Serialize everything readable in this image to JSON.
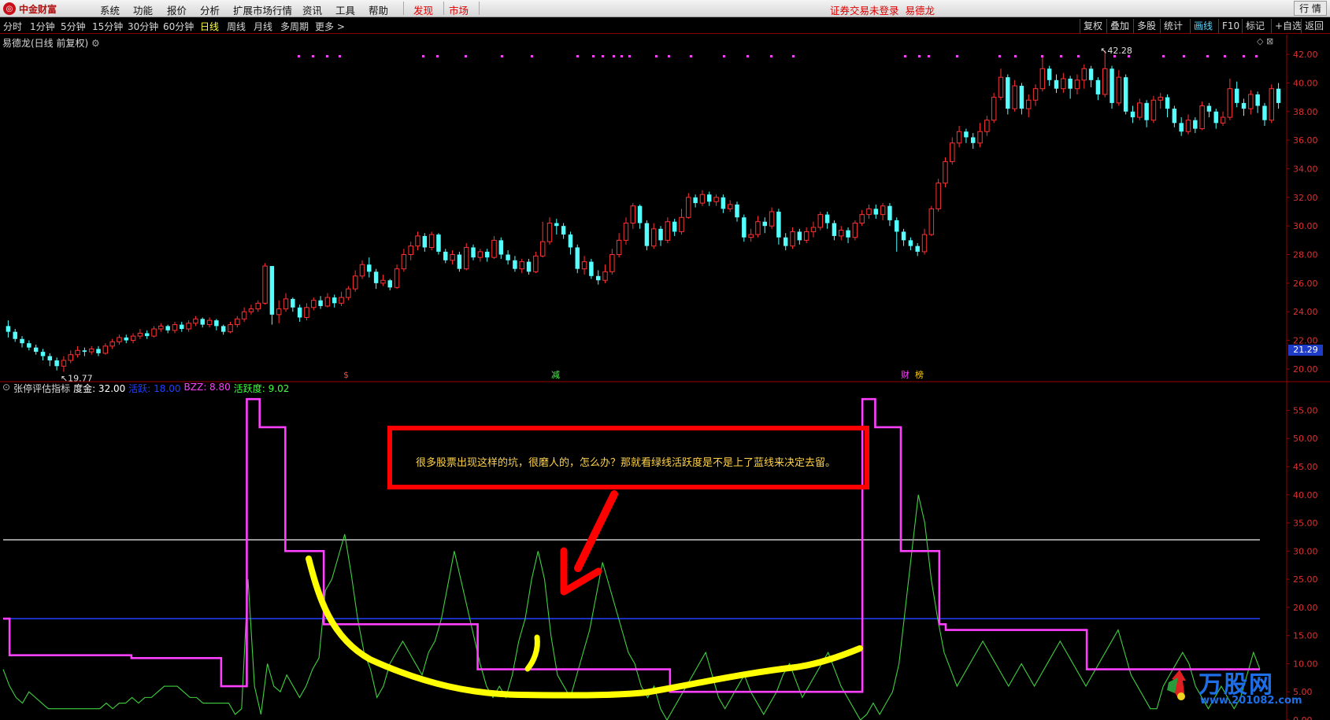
{
  "menubar": {
    "logo_text": "中金财富",
    "items": [
      "系统",
      "功能",
      "报价",
      "分析",
      "扩展市场行情",
      "资讯",
      "工具",
      "帮助"
    ],
    "highlight_items": [
      "发现",
      "市场"
    ],
    "login_status": "证券交易未登录",
    "stock_name": "易德龙",
    "window_button": "行 情"
  },
  "toolbar": {
    "periods": [
      "分时",
      "1分钟",
      "5分钟",
      "15分钟",
      "30分钟",
      "60分钟",
      "日线",
      "周线",
      "月线",
      "多周期",
      "更多 >"
    ],
    "active_period": "日线",
    "right_buttons": [
      "复权",
      "叠加",
      "多股",
      "统计",
      "画线",
      "F10",
      "标记",
      "+自选",
      "返回"
    ],
    "active_right": "画线"
  },
  "main_pane": {
    "title": "易德龙(日线 前复权)",
    "high_label": "42.28",
    "low_label": "19.77",
    "current_price": "21.29",
    "price_axis": [
      "42.00",
      "40.00",
      "38.00",
      "36.00",
      "34.00",
      "32.00",
      "30.00",
      "28.00",
      "26.00",
      "24.00",
      "22.00",
      "20.00"
    ],
    "event_markers": [
      {
        "text": "$",
        "color": "#ff4040"
      },
      {
        "text": "减",
        "color": "#40ff40"
      },
      {
        "text": "财",
        "color": "#ff40ff"
      },
      {
        "text": "榜",
        "color": "#ffcc00"
      }
    ]
  },
  "indicator_pane": {
    "name": "张停评估指标",
    "params": [
      {
        "label": "度金: 32.00",
        "color": "#ffffff"
      },
      {
        "label": "活跃: 18.00",
        "color": "#2040ff"
      },
      {
        "label": "BZZ: 8.80",
        "color": "#ff40ff"
      },
      {
        "label": "活跃度: 9.02",
        "color": "#40ff40"
      }
    ],
    "axis": [
      "55.00",
      "50.00",
      "45.00",
      "40.00",
      "35.00",
      "30.00",
      "25.00",
      "20.00",
      "15.00",
      "10.00",
      "5.00",
      "0.00"
    ]
  },
  "annotation": {
    "text": "很多股票出现这样的坑，很磨人的，怎么办？那就看绿线活跃度是不是上了蓝线来决定去留。"
  },
  "watermark": {
    "title": "万股网",
    "url": "www.201082.com"
  },
  "colors": {
    "up": "#ff3232",
    "down": "#54ffff",
    "bzz": "#ff40ff",
    "activity": "#40d040",
    "blue_line": "#2040ff",
    "white_line": "#c8c8c8",
    "annotation_arrow": "#ff0000",
    "highlight_curve": "#ffff00"
  },
  "chart_data": {
    "type": "line",
    "price_range": [
      19.5,
      42.5
    ],
    "indicator_range": [
      0,
      58
    ],
    "candles": [
      [
        23.0,
        22.6,
        23.4,
        22.2
      ],
      [
        22.6,
        22.1,
        22.8,
        21.9
      ],
      [
        22.1,
        21.8,
        22.3,
        21.5
      ],
      [
        21.8,
        21.5,
        22.0,
        21.3
      ],
      [
        21.5,
        21.2,
        21.7,
        21.0
      ],
      [
        21.2,
        20.9,
        21.4,
        20.6
      ],
      [
        20.9,
        20.6,
        21.1,
        20.2
      ],
      [
        20.6,
        20.2,
        20.8,
        19.9
      ],
      [
        20.2,
        20.6,
        20.9,
        19.8
      ],
      [
        20.6,
        21.0,
        21.3,
        20.4
      ],
      [
        21.0,
        21.3,
        21.6,
        20.8
      ],
      [
        21.3,
        21.2,
        21.5,
        20.9
      ],
      [
        21.2,
        21.4,
        21.6,
        21.0
      ],
      [
        21.4,
        21.1,
        21.6,
        20.9
      ],
      [
        21.1,
        21.6,
        21.8,
        21.0
      ],
      [
        21.6,
        21.9,
        22.1,
        21.4
      ],
      [
        21.9,
        22.2,
        22.4,
        21.7
      ],
      [
        22.2,
        22.0,
        22.4,
        21.8
      ],
      [
        22.0,
        22.3,
        22.5,
        21.8
      ],
      [
        22.3,
        22.5,
        22.8,
        22.1
      ],
      [
        22.5,
        22.3,
        22.7,
        22.1
      ],
      [
        22.3,
        22.8,
        23.0,
        22.2
      ],
      [
        22.8,
        23.0,
        23.2,
        22.6
      ],
      [
        23.0,
        22.7,
        23.1,
        22.5
      ],
      [
        22.7,
        23.1,
        23.3,
        22.5
      ],
      [
        23.1,
        22.8,
        23.3,
        22.6
      ],
      [
        22.8,
        23.2,
        23.4,
        22.6
      ],
      [
        23.2,
        23.5,
        23.7,
        23.0
      ],
      [
        23.5,
        23.1,
        23.6,
        22.9
      ],
      [
        23.1,
        23.4,
        23.6,
        22.9
      ],
      [
        23.4,
        23.0,
        23.5,
        22.7
      ],
      [
        23.0,
        22.6,
        23.1,
        22.4
      ],
      [
        22.6,
        23.1,
        23.3,
        22.5
      ],
      [
        23.1,
        23.5,
        23.7,
        22.9
      ],
      [
        23.5,
        24.0,
        24.3,
        23.3
      ],
      [
        24.0,
        24.2,
        24.5,
        23.8
      ],
      [
        24.2,
        24.6,
        24.8,
        24.0
      ],
      [
        24.6,
        27.2,
        27.4,
        24.5
      ],
      [
        27.2,
        23.8,
        27.0,
        23.1
      ],
      [
        23.8,
        24.2,
        24.8,
        23.2
      ],
      [
        24.2,
        24.9,
        25.3,
        24.0
      ],
      [
        24.9,
        24.3,
        25.0,
        24.0
      ],
      [
        24.3,
        23.6,
        24.5,
        23.3
      ],
      [
        23.6,
        24.3,
        24.6,
        23.4
      ],
      [
        24.3,
        24.8,
        25.0,
        24.1
      ],
      [
        24.8,
        24.4,
        25.1,
        24.2
      ],
      [
        24.4,
        25.0,
        25.3,
        24.3
      ],
      [
        25.0,
        24.6,
        25.2,
        24.3
      ],
      [
        24.6,
        25.0,
        25.4,
        24.4
      ],
      [
        25.0,
        25.6,
        25.8,
        24.8
      ],
      [
        25.6,
        26.5,
        26.9,
        25.4
      ],
      [
        26.5,
        27.3,
        27.6,
        26.3
      ],
      [
        27.3,
        26.8,
        27.8,
        26.4
      ],
      [
        26.8,
        26.0,
        27.0,
        25.6
      ],
      [
        26.0,
        26.2,
        26.6,
        25.8
      ],
      [
        26.2,
        25.7,
        26.3,
        25.5
      ],
      [
        25.7,
        27.0,
        27.3,
        25.6
      ],
      [
        27.0,
        28.0,
        28.4,
        26.8
      ],
      [
        28.0,
        28.6,
        28.9,
        27.6
      ],
      [
        28.6,
        29.3,
        29.6,
        28.3
      ],
      [
        29.3,
        28.5,
        29.5,
        28.2
      ],
      [
        28.5,
        29.4,
        29.6,
        28.3
      ],
      [
        29.4,
        28.2,
        29.5,
        28.0
      ],
      [
        28.2,
        27.6,
        28.4,
        27.4
      ],
      [
        27.6,
        28.0,
        28.3,
        27.3
      ],
      [
        28.0,
        27.0,
        28.2,
        26.8
      ],
      [
        27.0,
        28.5,
        28.8,
        26.9
      ],
      [
        28.5,
        27.8,
        28.7,
        27.6
      ],
      [
        27.8,
        28.2,
        28.4,
        27.5
      ],
      [
        28.2,
        27.8,
        28.4,
        27.5
      ],
      [
        27.8,
        29.0,
        29.3,
        27.7
      ],
      [
        29.0,
        28.0,
        29.2,
        27.7
      ],
      [
        28.0,
        27.6,
        28.3,
        27.3
      ],
      [
        27.6,
        27.0,
        27.9,
        26.8
      ],
      [
        27.0,
        27.5,
        27.7,
        26.7
      ],
      [
        27.5,
        26.8,
        27.7,
        26.6
      ],
      [
        26.8,
        27.9,
        28.2,
        26.7
      ],
      [
        27.9,
        28.9,
        30.3,
        27.8
      ],
      [
        28.9,
        30.2,
        30.6,
        28.7
      ],
      [
        30.2,
        30.0,
        30.5,
        29.4
      ],
      [
        30.0,
        29.4,
        30.2,
        29.1
      ],
      [
        29.4,
        28.5,
        29.6,
        28.0
      ],
      [
        28.5,
        27.0,
        28.7,
        26.7
      ],
      [
        27.0,
        27.5,
        27.9,
        26.6
      ],
      [
        27.5,
        26.5,
        27.7,
        26.3
      ],
      [
        26.5,
        26.2,
        26.9,
        25.9
      ],
      [
        26.2,
        26.8,
        27.3,
        26.0
      ],
      [
        26.8,
        28.0,
        28.4,
        26.6
      ],
      [
        28.0,
        29.0,
        29.5,
        27.8
      ],
      [
        29.0,
        30.2,
        30.6,
        28.7
      ],
      [
        30.2,
        31.4,
        31.6,
        29.8
      ],
      [
        31.4,
        30.2,
        31.5,
        29.8
      ],
      [
        30.2,
        28.6,
        30.4,
        28.3
      ],
      [
        28.6,
        29.8,
        30.2,
        28.4
      ],
      [
        29.8,
        29.0,
        30.0,
        28.6
      ],
      [
        29.0,
        30.3,
        30.6,
        28.8
      ],
      [
        30.3,
        29.6,
        30.5,
        29.3
      ],
      [
        29.6,
        30.6,
        31.2,
        29.4
      ],
      [
        30.6,
        32.0,
        32.3,
        30.5
      ],
      [
        32.0,
        31.6,
        32.2,
        31.3
      ],
      [
        31.6,
        32.2,
        32.5,
        31.4
      ],
      [
        32.2,
        31.7,
        32.4,
        31.4
      ],
      [
        31.7,
        32.0,
        32.2,
        31.4
      ],
      [
        32.0,
        31.2,
        32.2,
        30.9
      ],
      [
        31.2,
        31.5,
        31.8,
        31.0
      ],
      [
        31.5,
        30.6,
        31.7,
        30.3
      ],
      [
        30.6,
        29.2,
        30.8,
        28.9
      ],
      [
        29.2,
        29.4,
        29.8,
        28.9
      ],
      [
        29.4,
        30.3,
        30.7,
        29.2
      ],
      [
        30.3,
        30.0,
        30.6,
        29.5
      ],
      [
        30.0,
        31.0,
        31.3,
        29.8
      ],
      [
        31.0,
        29.2,
        31.2,
        28.7
      ],
      [
        29.2,
        28.6,
        29.5,
        28.3
      ],
      [
        28.6,
        29.6,
        29.9,
        28.4
      ],
      [
        29.6,
        29.0,
        29.8,
        28.7
      ],
      [
        29.0,
        29.6,
        29.9,
        28.8
      ],
      [
        29.6,
        29.9,
        30.3,
        29.2
      ],
      [
        29.9,
        30.8,
        31.0,
        29.7
      ],
      [
        30.8,
        30.2,
        31.0,
        29.8
      ],
      [
        30.2,
        29.3,
        30.4,
        29.0
      ],
      [
        29.3,
        29.7,
        30.0,
        29.0
      ],
      [
        29.7,
        29.2,
        29.9,
        28.8
      ],
      [
        29.2,
        30.2,
        30.4,
        29.0
      ],
      [
        30.2,
        30.8,
        31.1,
        30.0
      ],
      [
        30.8,
        31.2,
        31.5,
        30.5
      ],
      [
        31.2,
        30.8,
        31.5,
        30.5
      ],
      [
        30.8,
        31.4,
        31.6,
        30.4
      ],
      [
        31.4,
        30.4,
        31.6,
        30.0
      ],
      [
        30.4,
        29.6,
        30.6,
        28.2
      ],
      [
        29.6,
        29.0,
        29.8,
        28.6
      ],
      [
        29.0,
        28.6,
        29.2,
        28.3
      ],
      [
        28.6,
        28.2,
        28.8,
        27.9
      ],
      [
        28.2,
        29.4,
        29.8,
        28.0
      ],
      [
        29.4,
        31.2,
        31.4,
        29.3
      ],
      [
        31.2,
        33.0,
        33.3,
        31.0
      ],
      [
        33.0,
        34.5,
        34.8,
        32.7
      ],
      [
        34.5,
        35.8,
        36.2,
        34.3
      ],
      [
        35.8,
        36.6,
        37.0,
        35.5
      ],
      [
        36.6,
        36.2,
        36.8,
        35.8
      ],
      [
        36.2,
        35.8,
        36.5,
        35.4
      ],
      [
        35.8,
        36.6,
        37.2,
        35.5
      ],
      [
        36.6,
        37.4,
        37.7,
        36.3
      ],
      [
        37.4,
        39.0,
        39.3,
        37.2
      ],
      [
        39.0,
        40.4,
        41.0,
        38.8
      ],
      [
        40.4,
        38.2,
        40.6,
        37.8
      ],
      [
        38.2,
        39.8,
        40.2,
        38.0
      ],
      [
        39.8,
        38.2,
        40.0,
        37.8
      ],
      [
        38.2,
        38.8,
        39.2,
        37.6
      ],
      [
        38.8,
        39.6,
        39.9,
        38.4
      ],
      [
        39.6,
        41.0,
        41.9,
        39.4
      ],
      [
        41.0,
        40.2,
        41.2,
        39.8
      ],
      [
        40.2,
        39.6,
        40.6,
        39.3
      ],
      [
        39.6,
        40.3,
        40.7,
        39.3
      ],
      [
        40.3,
        39.6,
        40.5,
        38.9
      ],
      [
        39.6,
        40.2,
        40.6,
        39.2
      ],
      [
        40.2,
        41.0,
        41.3,
        39.6
      ],
      [
        41.0,
        40.2,
        41.2,
        39.7
      ],
      [
        40.2,
        39.2,
        40.4,
        38.8
      ],
      [
        39.2,
        41.0,
        42.28,
        39.0
      ],
      [
        41.0,
        38.6,
        41.2,
        38.2
      ],
      [
        38.6,
        40.4,
        40.9,
        38.4
      ],
      [
        40.4,
        38.0,
        40.6,
        37.8
      ],
      [
        38.0,
        37.6,
        38.4,
        37.2
      ],
      [
        37.6,
        38.6,
        38.9,
        37.4
      ],
      [
        38.6,
        37.4,
        38.8,
        36.9
      ],
      [
        37.4,
        38.8,
        39.1,
        37.2
      ],
      [
        38.8,
        39.0,
        39.3,
        38.2
      ],
      [
        39.0,
        38.2,
        39.2,
        37.6
      ],
      [
        38.2,
        37.2,
        38.4,
        36.9
      ],
      [
        37.2,
        36.6,
        37.6,
        36.3
      ],
      [
        36.6,
        37.4,
        37.8,
        36.4
      ],
      [
        37.4,
        36.8,
        37.6,
        36.5
      ],
      [
        36.8,
        38.4,
        38.7,
        36.7
      ],
      [
        38.4,
        38.0,
        38.6,
        37.6
      ],
      [
        38.0,
        37.2,
        38.2,
        36.8
      ],
      [
        37.2,
        37.6,
        38.0,
        37.0
      ],
      [
        37.6,
        39.6,
        40.3,
        37.4
      ],
      [
        39.6,
        38.6,
        40.1,
        38.3
      ],
      [
        38.6,
        38.2,
        38.9,
        37.7
      ],
      [
        38.2,
        39.2,
        39.5,
        37.8
      ],
      [
        39.2,
        38.4,
        39.4,
        37.9
      ],
      [
        38.4,
        37.4,
        38.6,
        37.0
      ],
      [
        37.4,
        39.6,
        39.9,
        37.2
      ],
      [
        39.6,
        38.6,
        40.0,
        38.2
      ]
    ],
    "bzz_series": [
      18,
      11.5,
      11.5,
      11.5,
      11.5,
      11.5,
      11.5,
      11.5,
      11.5,
      11.5,
      11.5,
      11.5,
      11.5,
      11.5,
      11.5,
      11.5,
      11.5,
      11.5,
      11.5,
      11.5,
      11,
      11,
      11,
      11,
      11,
      11,
      11,
      11,
      11,
      11,
      11,
      11,
      11,
      11,
      6,
      6,
      6,
      6,
      57,
      57,
      52,
      52,
      52,
      52,
      30,
      30,
      30,
      30,
      30,
      30,
      17,
      17,
      17,
      17,
      17,
      17,
      17,
      17,
      17,
      17,
      17,
      17,
      17,
      17,
      17,
      17,
      17,
      17,
      17,
      17,
      17,
      17,
      17,
      17,
      9,
      9,
      9,
      9,
      9,
      9,
      9,
      9,
      9,
      9,
      9,
      9,
      9,
      9,
      9,
      9,
      9,
      9,
      9,
      9,
      9,
      9,
      9,
      9,
      9,
      9,
      9,
      9,
      9,
      9,
      5,
      5,
      5,
      5,
      5,
      5,
      5,
      5,
      5,
      5,
      5,
      5,
      5,
      5,
      5,
      5,
      5,
      5,
      5,
      5,
      5,
      5,
      5,
      5,
      5,
      5,
      5,
      5,
      5,
      5,
      57,
      57,
      52,
      52,
      52,
      52,
      30,
      30,
      30,
      30,
      30,
      30,
      17,
      16,
      16,
      16,
      16,
      16,
      16,
      16,
      16,
      16,
      16,
      16,
      16,
      16,
      16,
      16,
      16,
      16,
      16,
      16,
      16,
      16,
      16,
      9,
      9,
      9,
      9,
      9,
      9,
      9,
      9,
      9,
      9,
      9,
      9,
      9,
      9,
      9,
      9,
      9,
      9,
      9,
      9,
      9,
      9,
      9,
      9,
      9,
      9,
      9,
      9
    ],
    "activity_series": [
      9,
      6,
      4,
      3,
      5,
      4,
      3,
      2,
      2,
      2,
      2,
      2,
      2,
      2,
      2,
      2,
      3,
      2,
      3,
      3,
      4,
      3,
      4,
      4,
      5,
      6,
      6,
      6,
      5,
      4,
      4,
      3,
      3,
      3,
      3,
      3,
      1,
      2,
      25,
      6,
      1,
      10,
      6,
      5,
      8,
      6,
      4,
      6,
      9,
      11,
      23,
      25,
      29,
      33,
      26,
      18,
      12,
      9,
      4,
      6,
      10,
      12,
      14,
      12,
      10,
      8,
      12,
      14,
      18,
      24,
      30,
      25,
      20,
      15,
      10,
      6,
      4,
      6,
      4,
      8,
      14,
      18,
      25,
      30,
      25,
      15,
      8,
      6,
      4,
      8,
      12,
      16,
      22,
      28,
      24,
      20,
      16,
      12,
      10,
      6,
      4,
      6,
      2,
      0,
      2,
      4,
      6,
      8,
      10,
      12,
      8,
      4,
      2,
      4,
      6,
      8,
      5,
      3,
      1,
      3,
      5,
      8,
      10,
      7,
      4,
      6,
      8,
      10,
      12,
      9,
      6,
      4,
      2,
      0,
      1,
      3,
      1,
      3,
      5,
      10,
      20,
      30,
      40,
      35,
      25,
      18,
      12,
      9,
      6,
      8,
      10,
      12,
      14,
      12,
      10,
      8,
      6,
      8,
      10,
      8,
      6,
      8,
      10,
      12,
      14,
      12,
      10,
      8,
      6,
      8,
      10,
      12,
      14,
      16,
      12,
      8,
      6,
      4,
      2,
      2,
      6,
      8,
      10,
      12,
      10,
      6,
      4,
      2,
      4,
      6,
      4,
      2,
      4,
      8,
      12,
      9
    ]
  }
}
